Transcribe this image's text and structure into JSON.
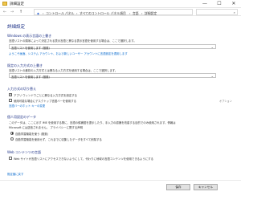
{
  "window": {
    "title": "詳細設定",
    "minimize": "—",
    "maximize": "☐",
    "close": "✕"
  },
  "address": {
    "back": "←",
    "forward": "→",
    "up": "↑",
    "breadcrumb": [
      "コントロール パネル",
      "すべてのコントロール パネル項目",
      "言語",
      "詳細設定"
    ],
    "separator": "›",
    "search_icon": "⌕"
  },
  "page": {
    "title": "詳細設定"
  },
  "sections": {
    "display_lang": {
      "heading": "Windows の表示言語の上書き",
      "desc": "言語リストの順序によって決定される表示言語と異なる表示言語を使用する場合は、ここで選択します。",
      "selected": "言語リストを使用します (推奨)",
      "link": "ようこそ画面、システム アカウント、および新しいユーザー アカウントに言語設定を適用します"
    },
    "input_method": {
      "heading": "既定の入力方式の上書き",
      "desc": "言語リストの最初の入力方式とは異なる入力方式を使用する場合は、ここで選択します。",
      "selected": "言語リストを使用します (推奨)"
    },
    "switching": {
      "heading": "入力方式の切り替え",
      "opt1": "アプリ ウィンドウごとに異なる入力方式を設定する",
      "opt2": "使用可能な場合にデスクトップ言語バーを使用する",
      "opt2_tag": "オプション",
      "link": "言語バーのホット キーの変更"
    },
    "personalization": {
      "heading": "個人用設定のデータ",
      "desc1": "このデータは、ここに示す IME を使用する際に、言語の候補語を提示したり、手入力の認識を改善する目的でのみ使用されます。情報は",
      "desc2": "Microsoft には送信されません。 プライバシーに関する声明",
      "radio1": "自動学習機能を使う (推奨)",
      "radio2": "自動学習機能を使用せず、これまでに収集したデータをすべて削除する"
    },
    "web": {
      "heading": "Web コンテンツの言語",
      "opt1": "Web サイトが言語リストにアクセスできないようにして、代わりに地域の言語コンテンツを使用できるようにする"
    }
  },
  "footer": {
    "restore_link": "既定値に戻す",
    "save": "保存",
    "cancel": "キャンセル"
  },
  "colors": {
    "heading": "#1e3287",
    "link": "#0066cc"
  }
}
